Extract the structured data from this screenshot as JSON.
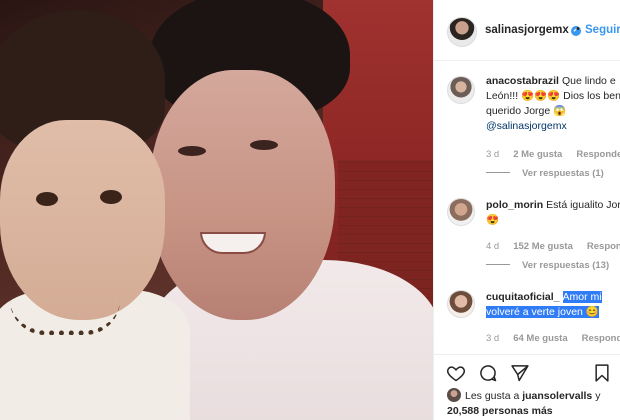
{
  "post": {
    "photo_description_icon": "photo"
  },
  "header": {
    "username": "salinasjorgemx",
    "separator": "•",
    "follow_label": "Seguir"
  },
  "comments": [
    {
      "username": "anacostabrazil",
      "text": "Que lindo e León!!! 😍😍😍 Dios los ben mi querido Jorge 😱",
      "mention": "@salinasjorgemx",
      "time": "3 d",
      "likes": "2 Me gusta",
      "reply": "Responde",
      "view_replies": "Ver respuestas (1)"
    },
    {
      "username": "polo_morin",
      "text": "Está igualito Jorge! 😍",
      "time": "4 d",
      "likes": "152 Me gusta",
      "reply": "Responde",
      "view_replies": "Ver respuestas (13)"
    },
    {
      "username": "cuquitaoficial_",
      "selected_text": "Amor mi volveré a verte joven 😊",
      "time": "3 d",
      "likes": "64 Me gusta",
      "reply": "Responde"
    }
  ],
  "likes_summary": {
    "prefix": "Les gusta a",
    "user": "juansolervalls",
    "connector": "y",
    "count": "20,588 personas más"
  },
  "colors": {
    "accent": "#3897f0",
    "selection": "#2f7cf6"
  }
}
